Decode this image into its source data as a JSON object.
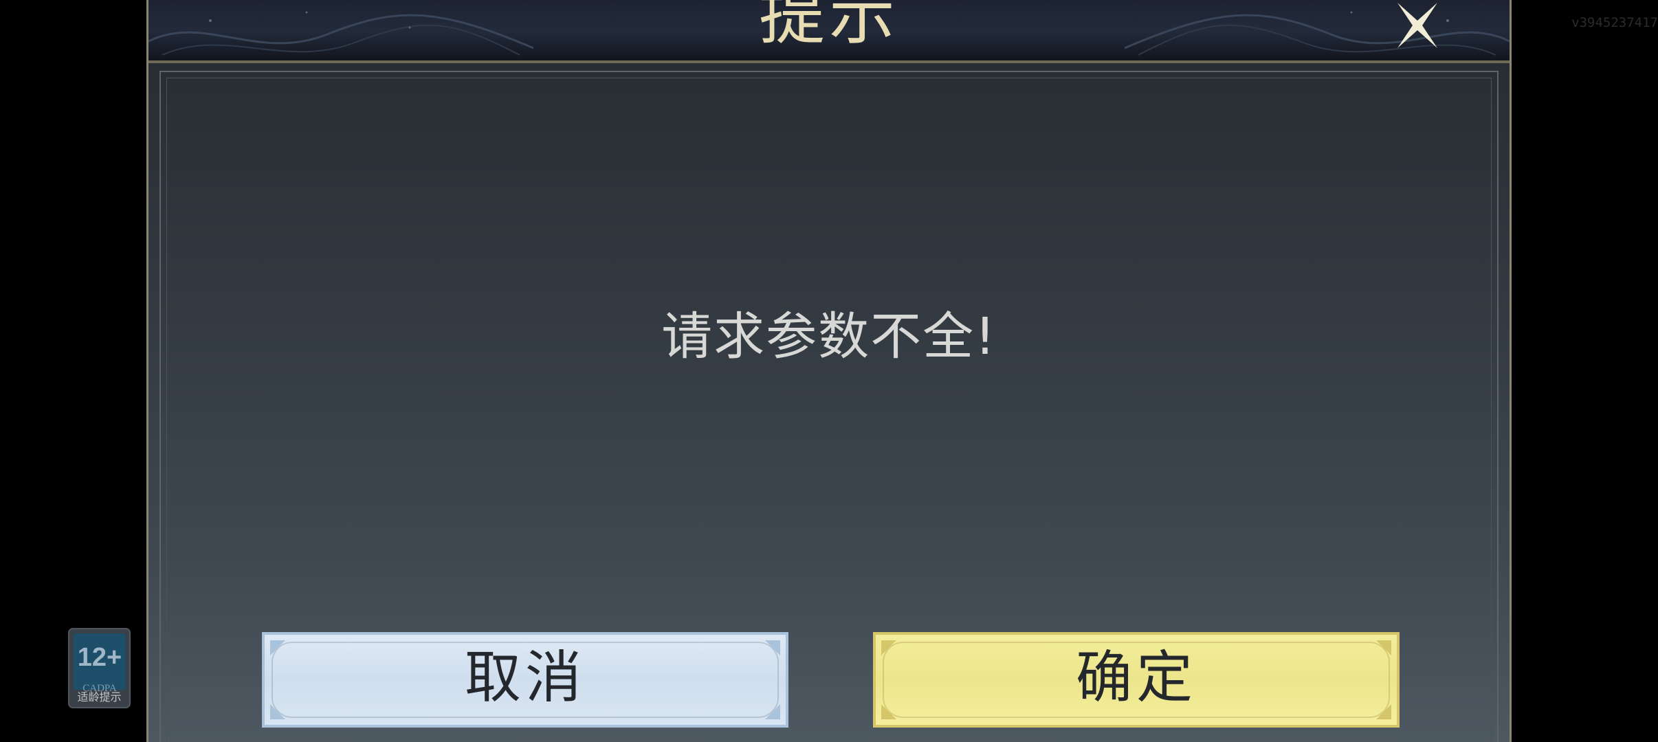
{
  "dialog": {
    "title": "提示",
    "message": "请求参数不全!",
    "cancel_label": "取消",
    "confirm_label": "确定",
    "close_icon": "close-icon"
  },
  "overlay": {
    "version": "v3945237417",
    "age_rating": {
      "number": "12+",
      "org": "CADPA",
      "label": "适龄提示"
    }
  },
  "colors": {
    "title_gold": "#e8dcb2",
    "cancel_bg": "#dfe9f4",
    "confirm_bg": "#f3ee9c",
    "panel_dark": "#252a2f"
  }
}
